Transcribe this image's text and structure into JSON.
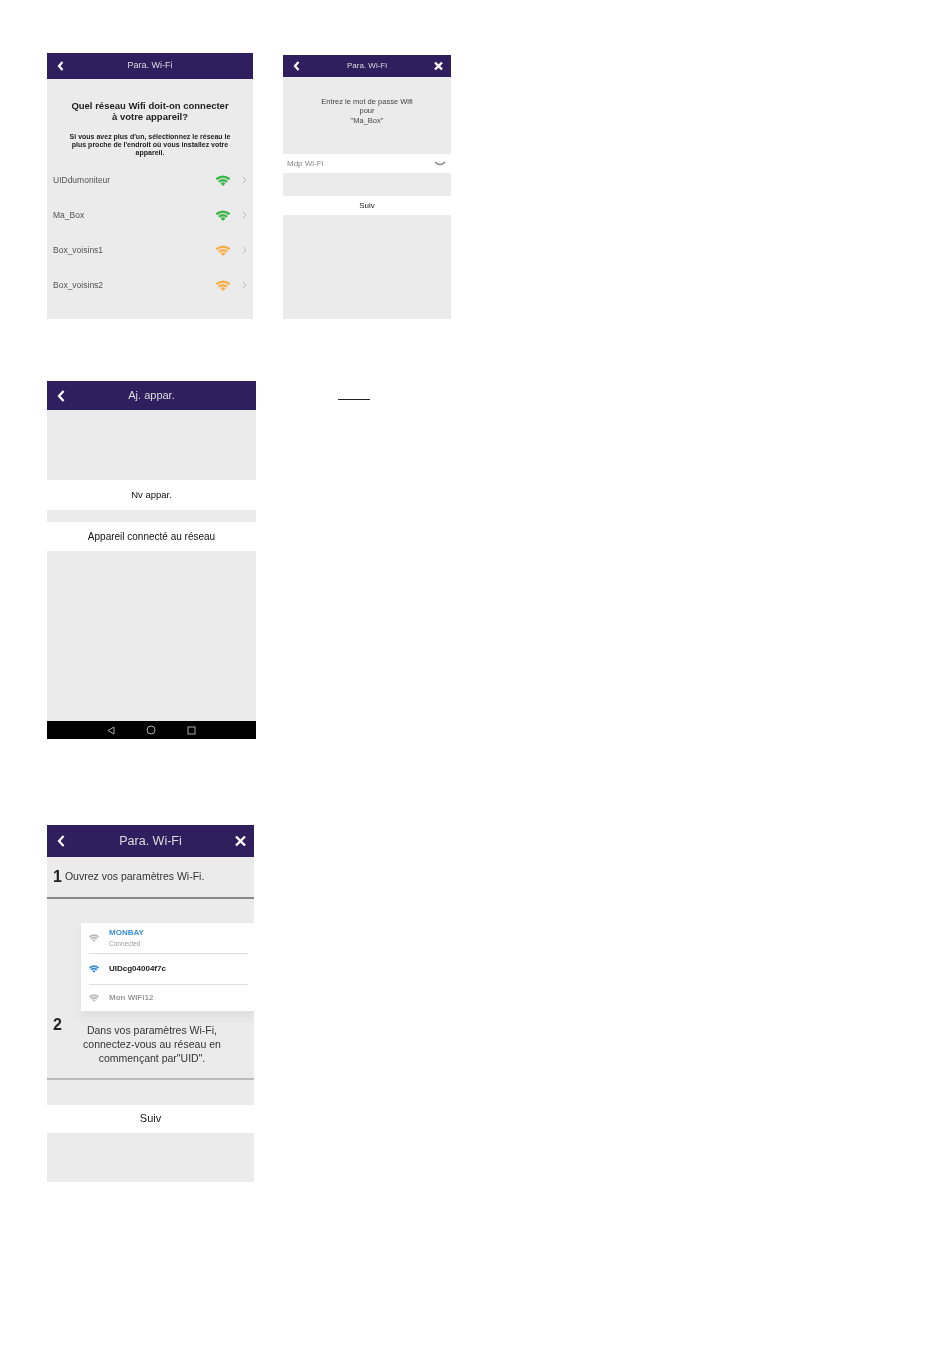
{
  "screens": [
    {
      "kind": "network_list",
      "header": {
        "title": "Para. Wi-Fi",
        "close": false
      },
      "question": "Quel réseau Wifi doit-on connecter à votre appareil?",
      "hint": "Si vous avez plus d'un, sélectionnez le réseau le plus proche de l'endroit où vous installez votre appareil.",
      "networks": [
        {
          "name": "UIDdumoniteur",
          "color": "#3cb54a"
        },
        {
          "name": "Ma_Box",
          "color": "#3cb54a"
        },
        {
          "name": "Box_voisins1",
          "color": "#f5b04a"
        },
        {
          "name": "Box_voisins2",
          "color": "#f5b04a"
        }
      ]
    },
    {
      "kind": "password",
      "header": {
        "title": "Para. Wi-Fi",
        "close": true
      },
      "prompt": "Entrez le mot de passe Wifi pour",
      "network": "\"Ma_Box\"",
      "field": {
        "placeholder": "Mdp Wi-Fi"
      },
      "next_button": "Suiv"
    },
    {
      "kind": "add_device",
      "header": {
        "title": "Aj. appar.",
        "close": false
      },
      "buttons": [
        "Nv appar.",
        "Appareil connecté au réseau"
      ],
      "nav_bar": true
    },
    {
      "kind": "instructions",
      "header": {
        "title": "Para. Wi-Fi",
        "close": true
      },
      "steps": [
        {
          "number": "1",
          "text": "Ouvrez vos paramètres Wi-Fi."
        },
        {
          "number": "2",
          "text": "Dans vos paramètres Wi-Fi, connectez-vous au réseau en commençant par\"UID\".",
          "example": [
            {
              "kind": "connected",
              "name": "MONBAY",
              "status": "Connected"
            },
            {
              "kind": "highlighted",
              "name": "UIDcg04004f7c"
            },
            {
              "kind": "faded",
              "name": "Mon WiFi12"
            }
          ]
        }
      ],
      "next_button": "Suiv"
    }
  ]
}
